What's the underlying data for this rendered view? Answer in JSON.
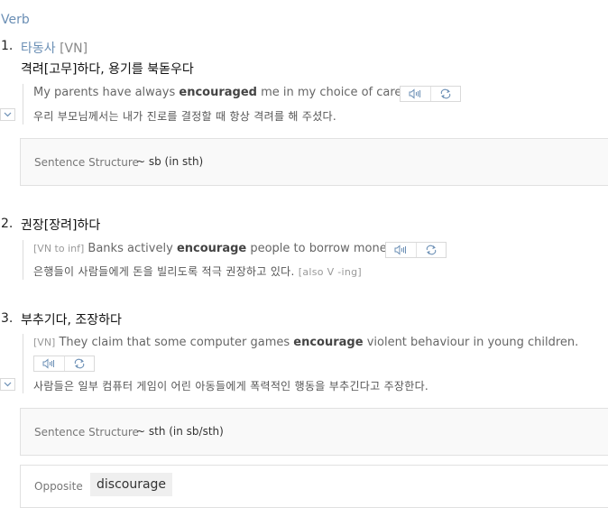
{
  "pos_label": "Verb",
  "senses": [
    {
      "number": "1.",
      "label": "타동사",
      "code": "[VN]",
      "definition": "격려[고무]하다, 용기를 북돋우다",
      "example_en": {
        "pre": "My parents have always ",
        "bold": "encouraged",
        "post": " me in my choice of career."
      },
      "example_ko": "우리 부모님께서는 내가 진로를 결정할 때 항상 격려를 해 주셨다.",
      "structure_label": "Sentence Structure",
      "structure_value": "~ sb (in sth)"
    },
    {
      "number": "2.",
      "definition": "권장[장려]하다",
      "example_tag": "[VN to inf]",
      "example_en": {
        "pre": " Banks actively ",
        "bold": "encourage",
        "post": " people to borrow money."
      },
      "example_ko": "은행들이 사람들에게 돈을 빌리도록 적극 권장하고 있다.",
      "example_ko_tag": "[also V -ing]"
    },
    {
      "number": "3.",
      "definition": "부추기다, 조장하다",
      "example_tag": "[VN]",
      "example_en": {
        "pre": " They claim that some computer games ",
        "bold": "encourage",
        "post": " violent behaviour in young children."
      },
      "example_ko": "사람들은 일부 컴퓨터 게임이 어린 아동들에게 폭력적인 행동을 부추긴다고 주장한다.",
      "structure_label": "Sentence Structure",
      "structure_value": "~ sth (in sb/sth)"
    }
  ],
  "opposite": {
    "label": "Opposite",
    "value": "discourage"
  },
  "icons": {
    "play": "speaker-icon",
    "repeat": "repeat-icon",
    "toggle": "chevron-down-icon"
  }
}
